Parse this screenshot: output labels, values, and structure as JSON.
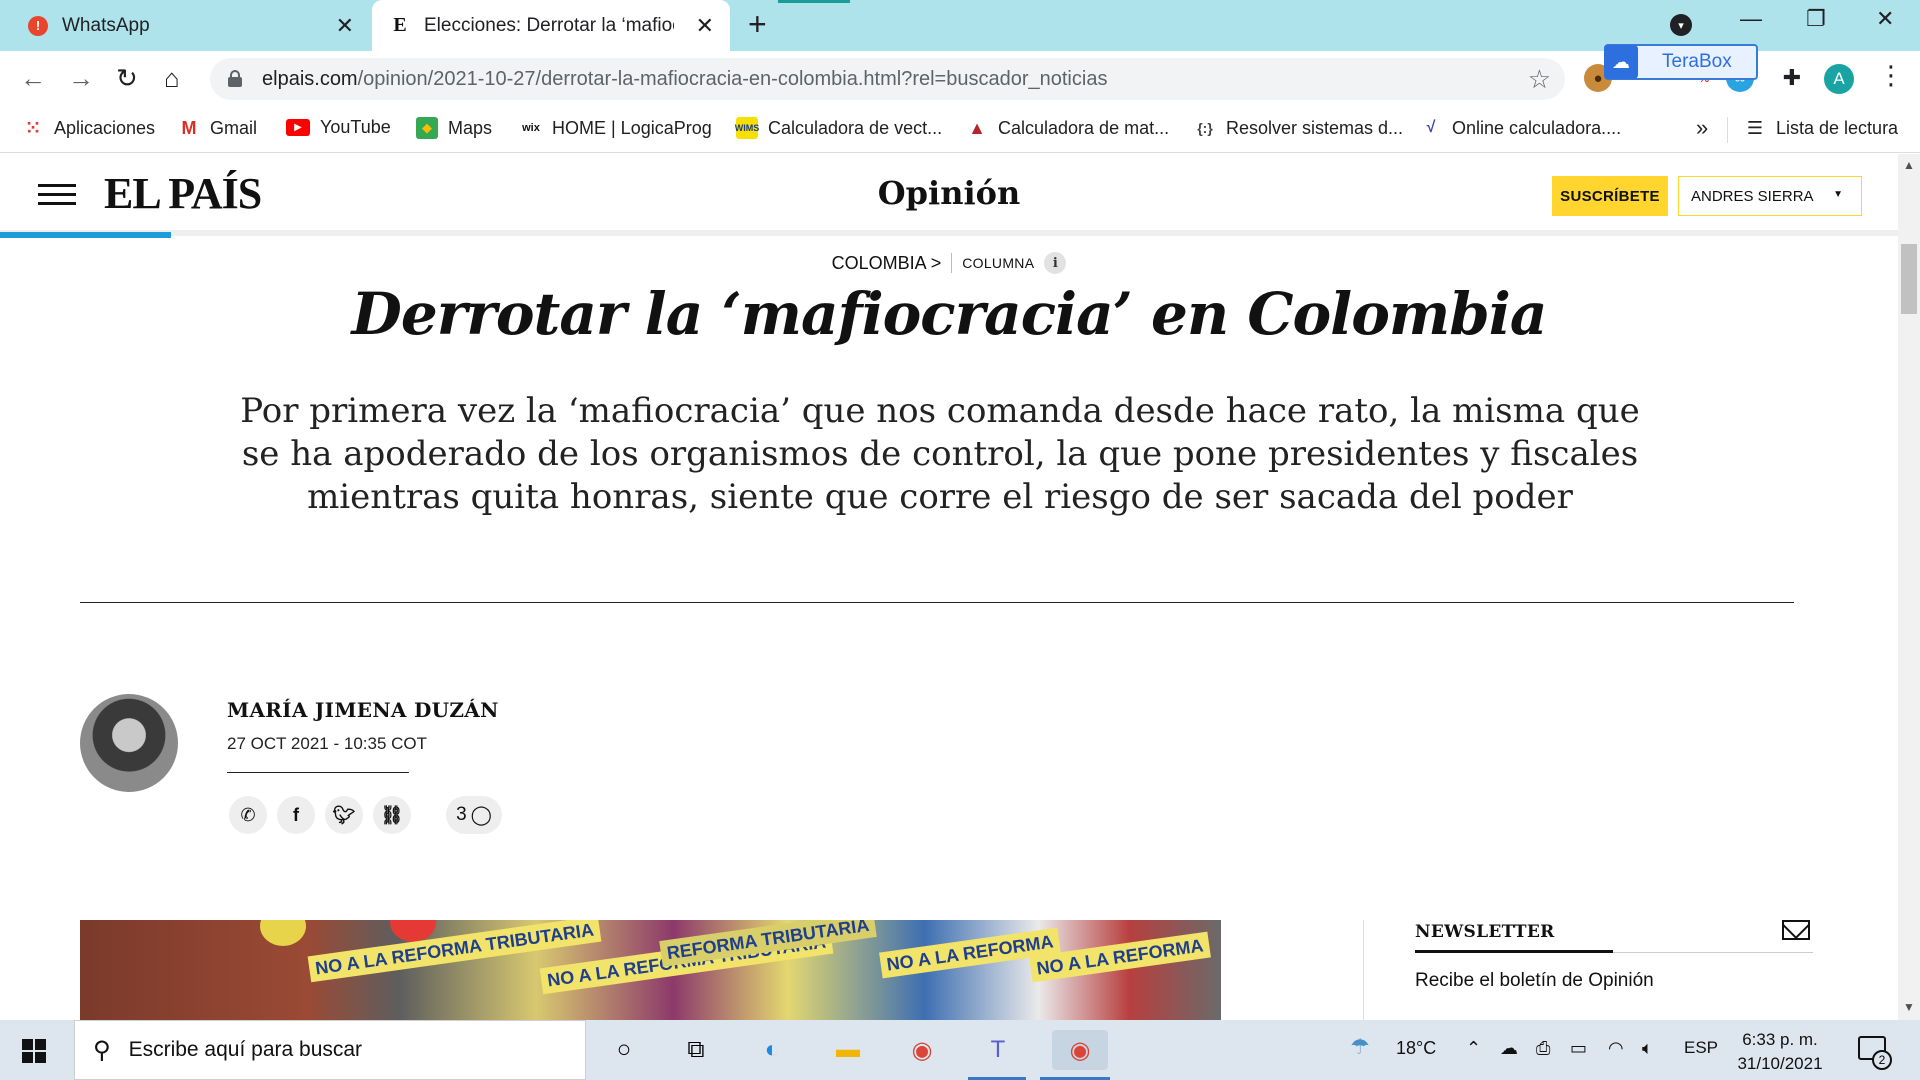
{
  "browser": {
    "tabs": [
      {
        "title": "WhatsApp",
        "icon": "whatsapp-alert-icon",
        "active": false
      },
      {
        "title": "Elecciones: Derrotar la ‘mafiocracia’ en Colombia",
        "icon": "elpais-e-icon",
        "active": true
      }
    ],
    "url_host": "elpais.com",
    "url_rest": "/opinion/2021-10-27/derrotar-la-mafiocracia-en-colombia.html?rel=buscador_noticias",
    "terabox_label": "TeraBox",
    "profile_initial": "A",
    "bookmarks": [
      {
        "label": "Aplicaciones",
        "icon": "apps-grid-icon"
      },
      {
        "label": "Gmail",
        "icon": "gmail-icon"
      },
      {
        "label": "YouTube",
        "icon": "youtube-icon"
      },
      {
        "label": "Maps",
        "icon": "maps-icon"
      },
      {
        "label": "HOME | LogicaProg",
        "icon": "wix-icon"
      },
      {
        "label": "Calculadora de vect...",
        "icon": "wims-icon"
      },
      {
        "label": "Calculadora de mat...",
        "icon": "matrix-calc-icon"
      },
      {
        "label": "Resolver sistemas d...",
        "icon": "systems-icon"
      },
      {
        "label": "Online calculadora....",
        "icon": "online-calc-icon"
      }
    ],
    "bookmarks_more": "»",
    "reading_list": "Lista de lectura"
  },
  "site": {
    "logo": "EL PAÍS",
    "section": "Opinión",
    "subscribe_label": "SUSCRÍBETE",
    "user_label": "ANDRES SIERRA",
    "accent_color": "#ffd52e",
    "progress_color": "#1f9dd8"
  },
  "article": {
    "kicker_section": "COLOMBIA >",
    "kicker_type": "COLUMNA",
    "info_glyph": "i",
    "headline": "Derrotar la ‘mafiocracia’ en Colombia",
    "standfirst": "Por primera vez la ‘mafiocracia’ que nos comanda desde hace rato, la misma que se ha apoderado de los organismos de control, la que pone presidentes y fiscales mientras quita honras, siente que corre el riesgo de ser sacada del poder",
    "author": "MARÍA JIMENA DUZÁN",
    "date": "27 OCT 2021 - 10:35 COT",
    "comment_count": "3",
    "photo_signs": [
      "NO A LA REFORMA TRIBUTARIA",
      "NO A LA REFORMA TRIBUTARIA",
      "REFORMA TRIBUTARIA",
      "NO A LA REFORMA",
      "NO A LA REFORMA"
    ]
  },
  "sidebar": {
    "newsletter_title": "NEWSLETTER",
    "newsletter_text": "Recibe el boletín de Opinión"
  },
  "taskbar": {
    "search_placeholder": "Escribe aquí para buscar",
    "temperature": "18°C",
    "language": "ESP",
    "time": "6:33 p. m.",
    "date": "31/10/2021",
    "notification_count": "2"
  }
}
